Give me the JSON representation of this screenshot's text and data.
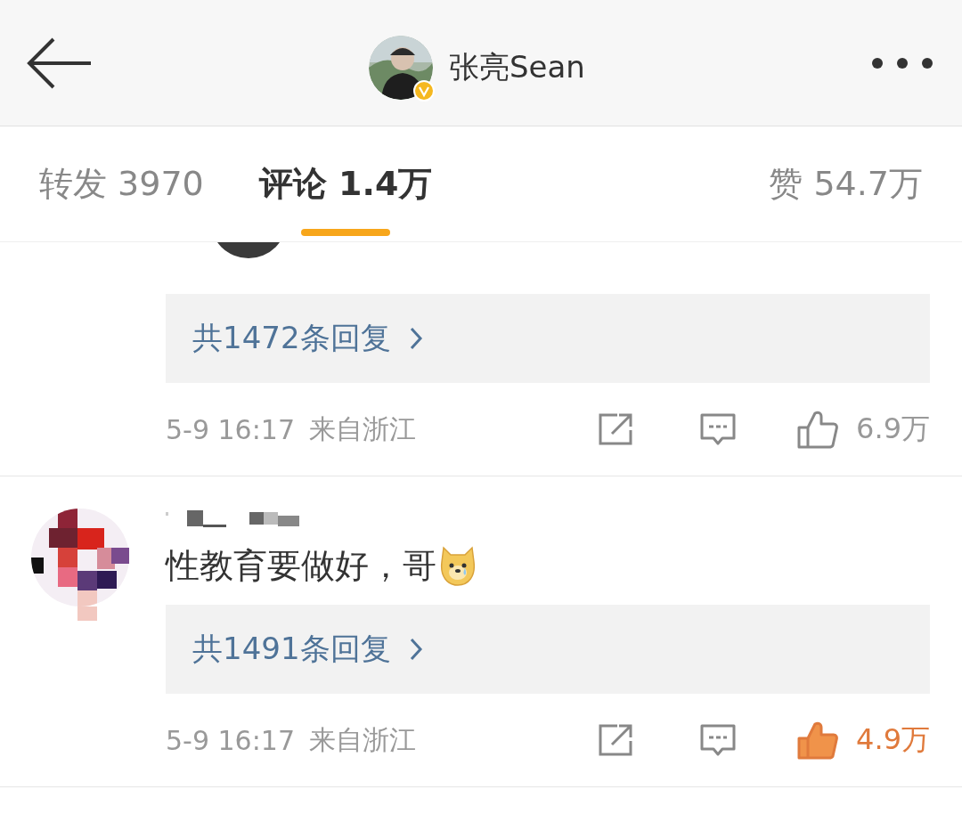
{
  "header": {
    "title": "张亮Sean",
    "verified": true
  },
  "tabs": [
    {
      "label": "转发 3970",
      "selected": false
    },
    {
      "label": "评论 1.4万",
      "selected": true
    },
    {
      "label": "赞 54.7万",
      "selected": false
    }
  ],
  "comments": [
    {
      "replies": "共1472条回复",
      "time": "5-9 16:17",
      "location": "来自浙江",
      "likes": "6.9万",
      "liked": false
    },
    {
      "text": "性教育要做好，哥",
      "replies": "共1491条回复",
      "time": "5-9 16:17",
      "location": "来自浙江",
      "likes": "4.9万",
      "liked": true
    }
  ]
}
